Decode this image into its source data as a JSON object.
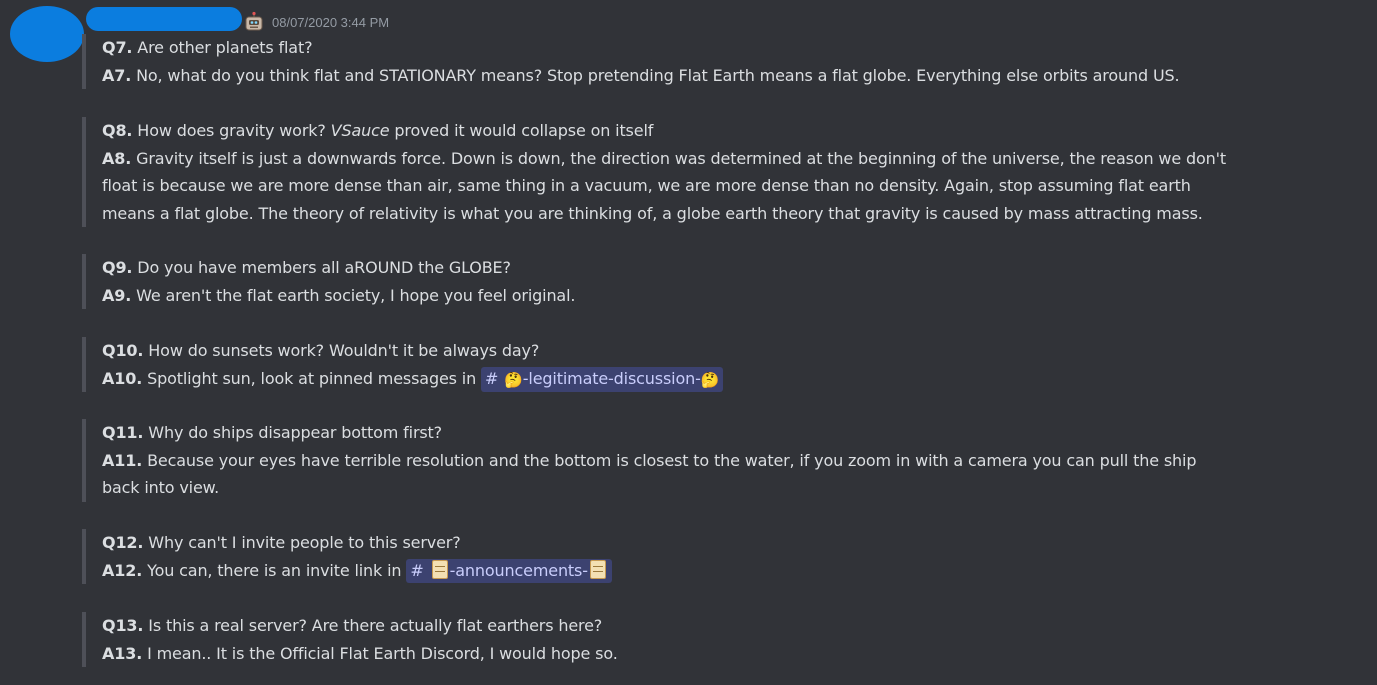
{
  "header": {
    "timestamp": "08/07/2020 3:44 PM",
    "bot_icon": "robot-icon"
  },
  "faq": [
    {
      "q_label": "Q7.",
      "q_text": " Are other planets flat?",
      "a_label": "A7.",
      "a_lines": [
        "No, what do you think flat and STATIONARY means? Stop pretending Flat Earth means a flat globe. Everything else orbits around US."
      ]
    },
    {
      "q_label": "Q8.",
      "q_text_before": " How does gravity work? ",
      "q_text_italic": "VSauce",
      "q_text_after": " proved it would collapse on itself",
      "a_label": "A8.",
      "a_lines": [
        "Gravity itself is just a downwards force. Down is down, the direction was determined at the beginning of the universe, the reason we don't",
        "float is because we are more dense than air, same thing in a vacuum, we are more dense than no density. Again, stop assuming flat earth",
        "means a flat globe.  The theory of relativity is what you are thinking of, a globe earth theory that gravity is caused by mass attracting mass."
      ]
    },
    {
      "q_label": "Q9.",
      "q_text": " Do you have members all aROUND the GLOBE?",
      "a_label": "A9.",
      "a_lines": [
        "We aren't the flat earth society, I hope you feel original."
      ]
    },
    {
      "q_label": "Q10.",
      "q_text": " How do sunsets work? Wouldn't it be always day?",
      "a_label": "A10.",
      "a_text": " Spotlight sun, look at pinned messages in ",
      "channel_hash": "#",
      "channel_emoji": "🤔",
      "channel_name": "-legitimate-discussion-"
    },
    {
      "q_label": "Q11.",
      "q_text": " Why do ships disappear bottom first?",
      "a_label": "A11.",
      "a_lines": [
        "Because your eyes have terrible resolution and the bottom is closest to the water, if you zoom in with a camera you can pull the ship",
        "back into view."
      ]
    },
    {
      "q_label": "Q12.",
      "q_text": " Why can't I invite people to this server?",
      "a_label": "A12.",
      "a_text": " You can, there is an invite link in ",
      "channel_hash": "#",
      "channel_emoji": "scroll-icon",
      "channel_name": "-announcements-"
    },
    {
      "q_label": "Q13.",
      "q_text": " Is this a real server? Are there actually flat earthers here?",
      "a_label": "A13.",
      "a_lines": [
        "I mean.. It is the Official Flat Earth Discord, I would hope so."
      ]
    }
  ]
}
